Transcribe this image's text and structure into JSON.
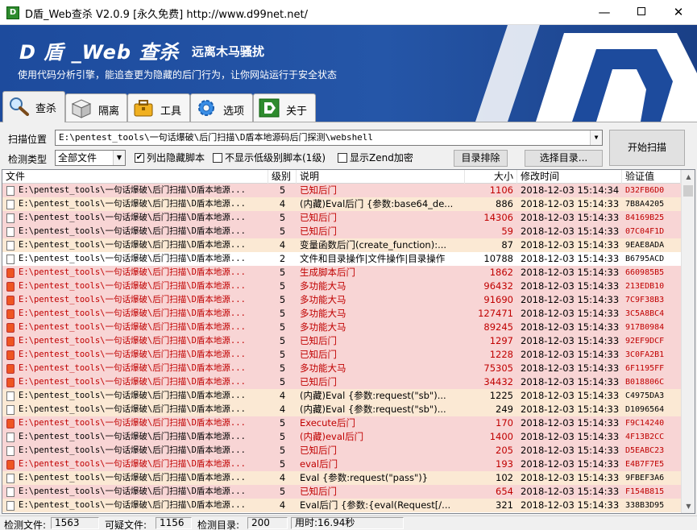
{
  "window": {
    "title": "D盾_Web查杀 V2.0.9 [永久免费] http://www.d99net.net/",
    "min_glyph": "—",
    "close_glyph": "✕"
  },
  "banner": {
    "title": "D 盾 _Web 查杀",
    "subtitle": "远离木马骚扰",
    "description": "使用代码分析引擎，能追查更为隐藏的后门行为，让你网站运行于安全状态",
    "logo_text": "D"
  },
  "tabs": [
    {
      "label": "查杀",
      "icon": "magnifier-icon",
      "active": true
    },
    {
      "label": "隔离",
      "icon": "box-icon",
      "active": false
    },
    {
      "label": "工具",
      "icon": "toolbox-icon",
      "active": false
    },
    {
      "label": "选项",
      "icon": "gear-icon",
      "active": false
    },
    {
      "label": "关于",
      "icon": "d-logo-icon",
      "active": false
    }
  ],
  "controls": {
    "scan_location_label": "扫描位置",
    "scan_path": "E:\\pentest_tools\\一句话爆破\\后门扫描\\D盾本地源码后门探测\\webshell",
    "detect_type_label": "检测类型",
    "detect_type_value": "全部文件",
    "cb_hidden_label": "列出隐藏脚本",
    "cb_hidden_checked": "✔",
    "cb_lowlevel_label": "不显示低级别脚本(1级)",
    "cb_zend_label": "显示Zend加密",
    "exclude_button": "目录排除",
    "choose_dir_button": "选择目录...",
    "scan_button": "开始扫描"
  },
  "table": {
    "columns": [
      "文件",
      "级别",
      "说明",
      "大小",
      "修改时间",
      "验证值"
    ],
    "rows": [
      {
        "file": "E:\\pentest_tools\\一句话爆破\\后门扫描\\D盾本地源...",
        "level": "5",
        "desc": "已知后门",
        "size": "1106",
        "time": "2018-12-03 15:14:34",
        "hash": "D32FB6D0",
        "hot": false
      },
      {
        "file": "E:\\pentest_tools\\一句话爆破\\后门扫描\\D盾本地源...",
        "level": "4",
        "desc": "(内藏)Eval后门 {参数:base64_de...",
        "size": "886",
        "time": "2018-12-03 15:14:33",
        "hash": "7B8A4205",
        "hot": false
      },
      {
        "file": "E:\\pentest_tools\\一句话爆破\\后门扫描\\D盾本地源...",
        "level": "5",
        "desc": "已知后门",
        "size": "14306",
        "time": "2018-12-03 15:14:33",
        "hash": "84169B25",
        "hot": false
      },
      {
        "file": "E:\\pentest_tools\\一句话爆破\\后门扫描\\D盾本地源...",
        "level": "5",
        "desc": "已知后门",
        "size": "59",
        "time": "2018-12-03 15:14:33",
        "hash": "07C04F1D",
        "hot": false
      },
      {
        "file": "E:\\pentest_tools\\一句话爆破\\后门扫描\\D盾本地源...",
        "level": "4",
        "desc": "变量函数后门(create_function):...",
        "size": "87",
        "time": "2018-12-03 15:14:33",
        "hash": "9EAE8ADA",
        "hot": false
      },
      {
        "file": "E:\\pentest_tools\\一句话爆破\\后门扫描\\D盾本地源...",
        "level": "2",
        "desc": "文件和目录操作|文件操作|目录操作",
        "size": "10788",
        "time": "2018-12-03 15:14:33",
        "hash": "B6795ACD",
        "hot": false
      },
      {
        "file": "E:\\pentest_tools\\一句话爆破\\后门扫描\\D盾本地源...",
        "level": "5",
        "desc": "生成脚本后门",
        "size": "1862",
        "time": "2018-12-03 15:14:33",
        "hash": "660985B5",
        "hot": true
      },
      {
        "file": "E:\\pentest_tools\\一句话爆破\\后门扫描\\D盾本地源...",
        "level": "5",
        "desc": "多功能大马",
        "size": "96432",
        "time": "2018-12-03 15:14:33",
        "hash": "213EDB10",
        "hot": true
      },
      {
        "file": "E:\\pentest_tools\\一句话爆破\\后门扫描\\D盾本地源...",
        "level": "5",
        "desc": "多功能大马",
        "size": "91690",
        "time": "2018-12-03 15:14:33",
        "hash": "7C9F38B3",
        "hot": true
      },
      {
        "file": "E:\\pentest_tools\\一句话爆破\\后门扫描\\D盾本地源...",
        "level": "5",
        "desc": "多功能大马",
        "size": "127471",
        "time": "2018-12-03 15:14:33",
        "hash": "3C5A8BC4",
        "hot": true
      },
      {
        "file": "E:\\pentest_tools\\一句话爆破\\后门扫描\\D盾本地源...",
        "level": "5",
        "desc": "多功能大马",
        "size": "89245",
        "time": "2018-12-03 15:14:33",
        "hash": "917B0984",
        "hot": true
      },
      {
        "file": "E:\\pentest_tools\\一句话爆破\\后门扫描\\D盾本地源...",
        "level": "5",
        "desc": "已知后门",
        "size": "1297",
        "time": "2018-12-03 15:14:33",
        "hash": "92EF9DCF",
        "hot": true
      },
      {
        "file": "E:\\pentest_tools\\一句话爆破\\后门扫描\\D盾本地源...",
        "level": "5",
        "desc": "已知后门",
        "size": "1228",
        "time": "2018-12-03 15:14:33",
        "hash": "3C0FA2B1",
        "hot": true
      },
      {
        "file": "E:\\pentest_tools\\一句话爆破\\后门扫描\\D盾本地源...",
        "level": "5",
        "desc": "多功能大马",
        "size": "75305",
        "time": "2018-12-03 15:14:33",
        "hash": "6F1195FF",
        "hot": true
      },
      {
        "file": "E:\\pentest_tools\\一句话爆破\\后门扫描\\D盾本地源...",
        "level": "5",
        "desc": "已知后门",
        "size": "34432",
        "time": "2018-12-03 15:14:33",
        "hash": "B018806C",
        "hot": true
      },
      {
        "file": "E:\\pentest_tools\\一句话爆破\\后门扫描\\D盾本地源...",
        "level": "4",
        "desc": "(内藏)Eval {参数:request(\"sb\")...",
        "size": "1225",
        "time": "2018-12-03 15:14:33",
        "hash": "C4975DA3",
        "hot": false
      },
      {
        "file": "E:\\pentest_tools\\一句话爆破\\后门扫描\\D盾本地源...",
        "level": "4",
        "desc": "(内藏)Eval {参数:request(\"sb\")...",
        "size": "249",
        "time": "2018-12-03 15:14:33",
        "hash": "D1096564",
        "hot": false
      },
      {
        "file": "E:\\pentest_tools\\一句话爆破\\后门扫描\\D盾本地源...",
        "level": "5",
        "desc": "Execute后门",
        "size": "170",
        "time": "2018-12-03 15:14:33",
        "hash": "F9C14240",
        "hot": true
      },
      {
        "file": "E:\\pentest_tools\\一句话爆破\\后门扫描\\D盾本地源...",
        "level": "5",
        "desc": "(内藏)eval后门",
        "size": "1400",
        "time": "2018-12-03 15:14:33",
        "hash": "4F13B2CC",
        "hot": false
      },
      {
        "file": "E:\\pentest_tools\\一句话爆破\\后门扫描\\D盾本地源...",
        "level": "5",
        "desc": "已知后门",
        "size": "205",
        "time": "2018-12-03 15:14:33",
        "hash": "D5EABC23",
        "hot": false
      },
      {
        "file": "E:\\pentest_tools\\一句话爆破\\后门扫描\\D盾本地源...",
        "level": "5",
        "desc": "eval后门",
        "size": "193",
        "time": "2018-12-03 15:14:33",
        "hash": "E4B7F7E5",
        "hot": true
      },
      {
        "file": "E:\\pentest_tools\\一句话爆破\\后门扫描\\D盾本地源...",
        "level": "4",
        "desc": "Eval {参数:request(\"pass\")}",
        "size": "102",
        "time": "2018-12-03 15:14:33",
        "hash": "9FBEF3A6",
        "hot": false
      },
      {
        "file": "E:\\pentest_tools\\一句话爆破\\后门扫描\\D盾本地源...",
        "level": "5",
        "desc": "已知后门",
        "size": "654",
        "time": "2018-12-03 15:14:33",
        "hash": "F154B815",
        "hot": false
      },
      {
        "file": "E:\\pentest_tools\\一句话爆破\\后门扫描\\D盾本地源...",
        "level": "4",
        "desc": "Eval后门 {参数:{eval(Request[/...",
        "size": "321",
        "time": "2018-12-03 15:14:33",
        "hash": "338B3D95",
        "hot": false
      }
    ]
  },
  "status": {
    "files_label": "检测文件:",
    "files_value": "1563",
    "suspicious_label": "可疑文件:",
    "suspicious_value": "1156",
    "dirs_label": "检测目录:",
    "dirs_value": "200",
    "time_text": "用时:16.94秒"
  },
  "colors": {
    "banner_blue": "#2556a8",
    "level5_row": "#f8d5d5",
    "level4_row": "#fbe9d4",
    "danger_text": "#c00000"
  }
}
